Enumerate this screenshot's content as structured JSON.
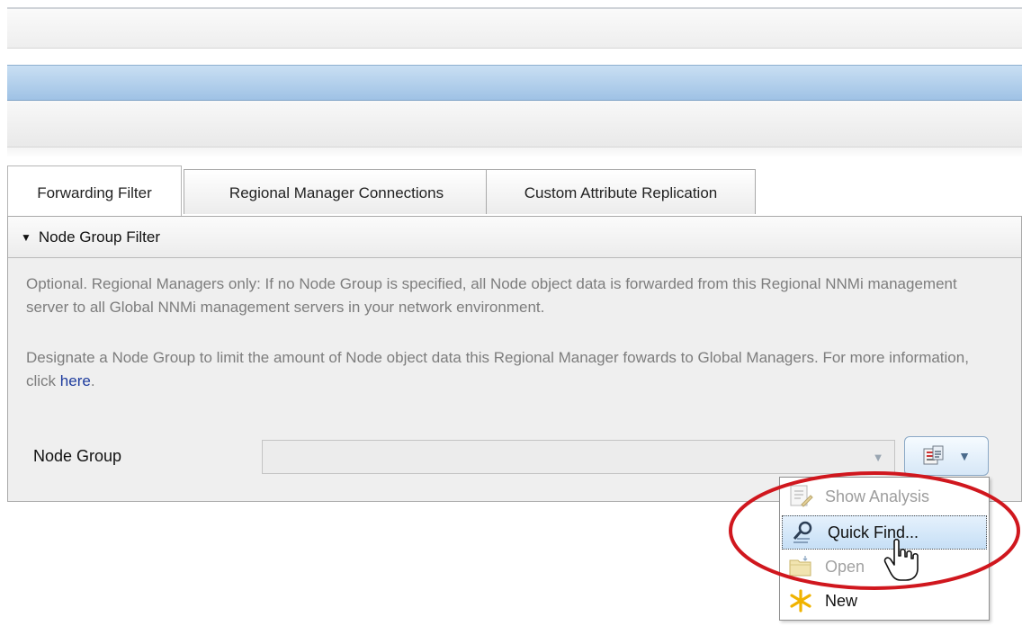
{
  "tabs": [
    {
      "label": "Forwarding Filter",
      "active": true
    },
    {
      "label": "Regional Manager Connections",
      "active": false
    },
    {
      "label": "Custom Attribute Replication",
      "active": false
    }
  ],
  "section": {
    "title": "Node Group Filter",
    "expanded": true
  },
  "description": {
    "para1": "Optional. Regional Managers only: If no Node Group is specified, all Node object data is forwarded from this Regional NNMi management server to all Global NNMi management servers in your network environment.",
    "para2_prefix": "Designate a Node Group to limit the amount of Node object data this Regional Manager fowards to Global Managers. For more information, click ",
    "para2_link": "here",
    "para2_suffix": "."
  },
  "field": {
    "label": "Node Group",
    "value": ""
  },
  "menu": {
    "items": [
      {
        "label": "Show Analysis",
        "icon": "show-analysis-icon",
        "enabled": false
      },
      {
        "label": "Quick Find...",
        "icon": "quick-find-icon",
        "enabled": true,
        "highlighted": true
      },
      {
        "label": "Open",
        "icon": "open-folder-icon",
        "enabled": false
      },
      {
        "label": "New",
        "icon": "new-asterisk-icon",
        "enabled": true
      }
    ]
  },
  "colors": {
    "highlight_ring": "#d0171e",
    "link": "#1e3c9e",
    "selected_band": "#9fc2e5"
  }
}
